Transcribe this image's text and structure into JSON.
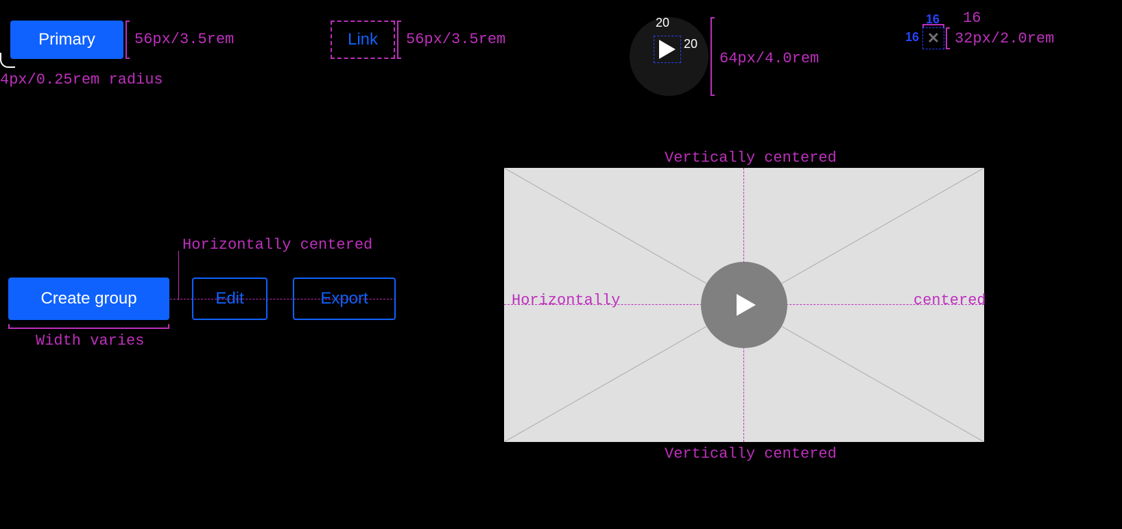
{
  "top": {
    "primary": {
      "label": "Primary",
      "height_dim": "56px/3.5rem",
      "radius_dim": "4px/0.25rem radius"
    },
    "link": {
      "label": "Link",
      "height_dim": "56px/3.5rem"
    },
    "play": {
      "icon_w": "20",
      "icon_h": "20",
      "diameter_dim": "64px/4.0rem"
    },
    "close": {
      "icon_w": "16",
      "icon_h": "16",
      "top_dim": "16",
      "size_dim": "32px/2.0rem"
    }
  },
  "group": {
    "create_label": "Create group",
    "edit_label": "Edit",
    "export_label": "Export",
    "hcenter_label": "Horizontally centered",
    "width_label": "Width varies"
  },
  "video": {
    "vcenter_label": "Vertically centered",
    "hcenter_left": "Horizontally",
    "hcenter_right": "centered"
  }
}
